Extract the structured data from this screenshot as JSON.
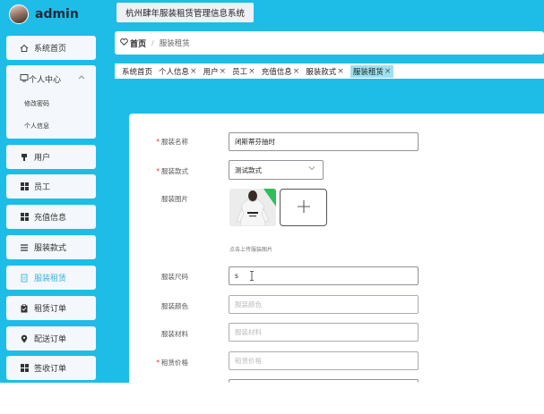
{
  "brand": {
    "name": "admin"
  },
  "system_title": "杭州肆年服装租赁管理信息系统",
  "sidebar": {
    "home": {
      "label": "系统首页",
      "icon": "home-icon"
    },
    "personal_center": {
      "label": "个人中心",
      "icon": "monitor-icon",
      "children": [
        "修改密码",
        "个人信息"
      ]
    },
    "items": [
      {
        "label": "用户",
        "icon": "user-icon",
        "active": false
      },
      {
        "label": "员工",
        "icon": "grid-icon",
        "active": false
      },
      {
        "label": "充值信息",
        "icon": "grid-icon",
        "active": false
      },
      {
        "label": "服装款式",
        "icon": "list-icon",
        "active": false
      },
      {
        "label": "服装租赁",
        "icon": "doc-icon",
        "active": true
      },
      {
        "label": "租赁订单",
        "icon": "clipboard-icon",
        "active": false
      },
      {
        "label": "配送订单",
        "icon": "pin-icon",
        "active": false
      },
      {
        "label": "签收订单",
        "icon": "grid-icon",
        "active": false
      }
    ]
  },
  "breadcrumb": {
    "home": "首页",
    "separator": "/",
    "current": "服装租赁"
  },
  "tabs": [
    {
      "label": "系统首页",
      "closable": false,
      "active": false
    },
    {
      "label": "个人信息",
      "closable": true,
      "active": false
    },
    {
      "label": "用户",
      "closable": true,
      "active": false
    },
    {
      "label": "员工",
      "closable": true,
      "active": false
    },
    {
      "label": "充值信息",
      "closable": true,
      "active": false
    },
    {
      "label": "服装款式",
      "closable": true,
      "active": false
    },
    {
      "label": "服装租赁",
      "closable": true,
      "active": true
    }
  ],
  "form": {
    "name": {
      "label": "服装名称",
      "required": true,
      "value": "闭斯蒂芬抽时"
    },
    "style": {
      "label": "服装款式",
      "required": true,
      "value": "测试款式"
    },
    "image": {
      "label": "服装图片",
      "hint": "点击上传服装图片"
    },
    "size": {
      "label": "服装尺码",
      "required": false,
      "value": "s"
    },
    "color": {
      "label": "服装颜色",
      "required": false,
      "placeholder": "服装颜色"
    },
    "material": {
      "label": "服装材料",
      "required": false,
      "placeholder": "服装材料"
    },
    "price": {
      "label": "租赁价格",
      "required": true,
      "placeholder": "租赁价格"
    }
  },
  "colors": {
    "accent": "#1dbde8",
    "active_text": "#3fb4d9",
    "required": "#e03535",
    "active_tab": "#9fe0f3"
  }
}
